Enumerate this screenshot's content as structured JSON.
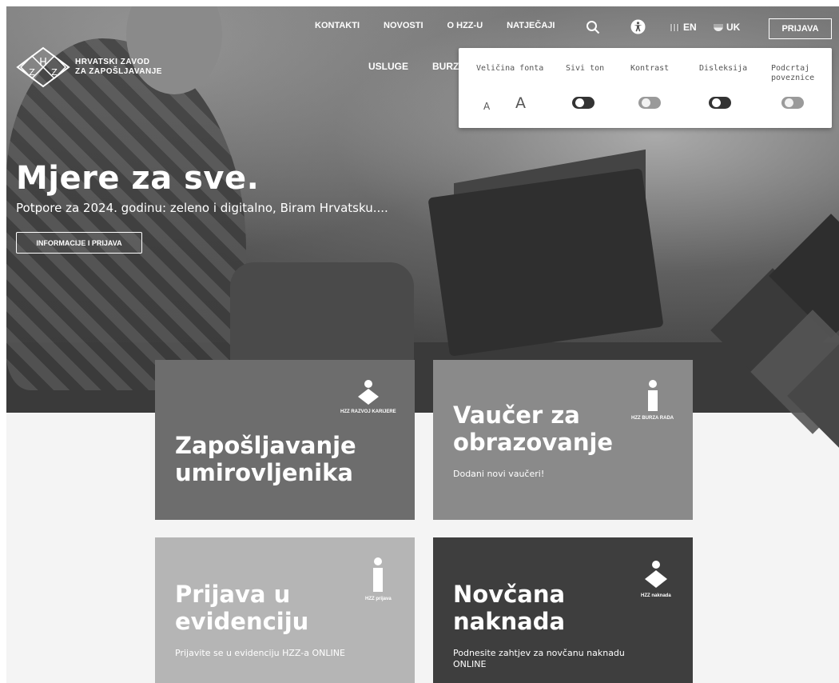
{
  "brand": {
    "line1": "HRVATSKI ZAVOD",
    "line2": "ZA ZAPOŠLJAVANJE",
    "logo_icon": "hzz-diamond-logo"
  },
  "topnav": {
    "items": [
      {
        "label": "KONTAKTI"
      },
      {
        "label": "NOVOSTI"
      },
      {
        "label": "O HZZ-U"
      },
      {
        "label": "NATJEČAJI"
      }
    ],
    "search_icon": "search-icon",
    "accessibility_icon": "accessibility-icon",
    "lang_en": "EN",
    "lang_uk": "UK",
    "login_label": "PRIJAVA"
  },
  "mainnav": {
    "items": [
      {
        "label": "USLUGE"
      },
      {
        "label": "BURZ"
      }
    ]
  },
  "accessibility_panel": {
    "font_size_label": "Veličina fonta",
    "font_small": "A",
    "font_large": "A",
    "grayscale_label": "Sivi ton",
    "grayscale_on": true,
    "contrast_label": "Kontrast",
    "contrast_on": false,
    "dyslexia_label": "Disleksija",
    "dyslexia_on": true,
    "underline_label_1": "Podcrtaj",
    "underline_label_2": "poveznice",
    "underline_on": false
  },
  "hero": {
    "title": "Mjere za sve.",
    "subtitle": "Potpore za 2024. godinu: zeleno i digitalno, Biram Hrvatsku....",
    "button_label": "INFORMACIJE I PRIJAVA"
  },
  "cards": [
    {
      "title_line1": "Zapošljavanje",
      "title_line2": "umirovljenika",
      "description": "",
      "badge_label": "HZZ RAZVOJ KARIJERE",
      "badge_icon": "diamond-person-icon",
      "color": "#6d6d6d"
    },
    {
      "title_line1": "Vaučer za",
      "title_line2": "obrazovanje",
      "description": "Dodani novi vaučeri!",
      "badge_label": "HZZ BURZA RADA",
      "badge_icon": "info-i-icon",
      "color": "#8a8a8a"
    },
    {
      "title_line1": "Prijava u",
      "title_line2": "evidenciju",
      "description": "Prijavite se u evidenciju HZZ-a ONLINE",
      "badge_label": "HZZ prijava",
      "badge_icon": "info-i-icon",
      "color": "#b5b5b5"
    },
    {
      "title_line1": "Novčana",
      "title_line2": "naknada",
      "description_line1": "Podnesite zahtjev za novčanu naknadu",
      "description_line2": "ONLINE",
      "badge_label": "HZZ naknada",
      "badge_icon": "diamond-person-icon",
      "color": "#3e3e3e"
    }
  ]
}
